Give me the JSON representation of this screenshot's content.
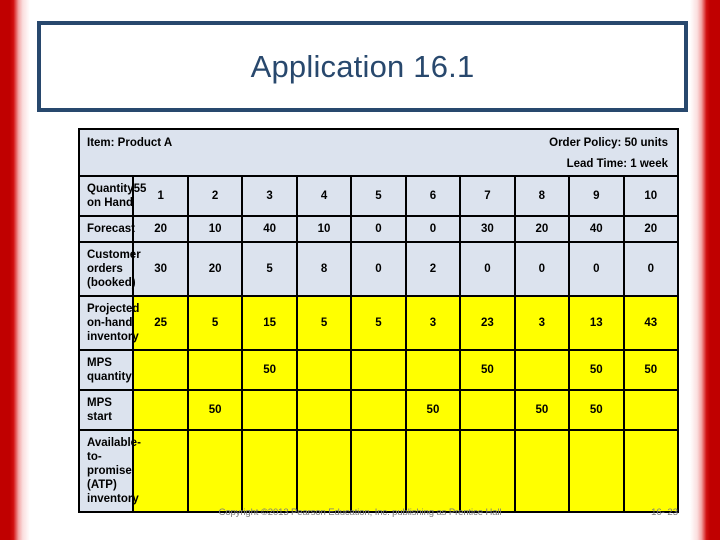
{
  "slide": {
    "title": "Application 16.1",
    "accent_color": "#28486d",
    "edge_color": "#c00000",
    "cell_color": "#dce3ee",
    "highlight_color": "#ffff00"
  },
  "table": {
    "info": {
      "item_label": "Item: Product A",
      "order_policy": "Order Policy: 50 units",
      "lead_time": "Lead Time: 1 week"
    },
    "quantity_on_hand": {
      "label": "Quantity on Hand",
      "value": "55"
    },
    "period_headers": [
      "1",
      "2",
      "3",
      "4",
      "5",
      "6",
      "7",
      "8",
      "9",
      "10"
    ],
    "rows": [
      {
        "label": "Forecast",
        "highlight": false,
        "values": [
          "20",
          "10",
          "40",
          "10",
          "0",
          "0",
          "30",
          "20",
          "40",
          "20"
        ]
      },
      {
        "label": "Customer orders (booked)",
        "highlight": false,
        "values": [
          "30",
          "20",
          "5",
          "8",
          "0",
          "2",
          "0",
          "0",
          "0",
          "0"
        ]
      },
      {
        "label": "Projected on-hand inventory",
        "highlight": true,
        "values": [
          "25",
          "5",
          "15",
          "5",
          "5",
          "3",
          "23",
          "3",
          "13",
          "43"
        ]
      },
      {
        "label": "MPS quantity",
        "highlight": true,
        "values": [
          "",
          "",
          "50",
          "",
          "",
          "",
          "50",
          "",
          "50",
          "50"
        ]
      },
      {
        "label": "MPS start",
        "highlight": true,
        "values": [
          "",
          "50",
          "",
          "",
          "",
          "50",
          "",
          "50",
          "50",
          ""
        ]
      },
      {
        "label": "Available-to-promise (ATP) inventory",
        "highlight": true,
        "values": [
          "",
          "",
          "",
          "",
          "",
          "",
          "",
          "",
          "",
          ""
        ]
      }
    ]
  },
  "footer": {
    "copyright": "Copyright ©2013 Pearson Education, Inc. publishing as Prentice Hall",
    "page_number": "16- 23"
  }
}
